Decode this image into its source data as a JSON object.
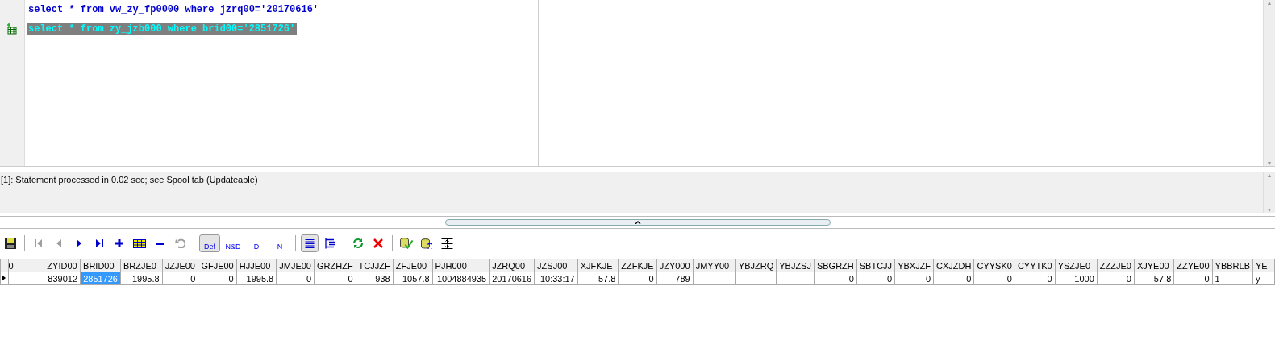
{
  "editor": {
    "lines": [
      {
        "text": "select * from vw_zy_fp0000 where jzrq00='20170616'",
        "selected": false,
        "marker": false
      },
      {
        "text": "select * from zy_jzb000 where brid00='2851726'",
        "selected": true,
        "marker": true
      }
    ]
  },
  "message": {
    "text": "[1]: Statement processed in 0.02 sec; see Spool tab (Updateable)"
  },
  "toolbar": [
    {
      "kind": "icon",
      "disabled": false,
      "selected": false
    },
    {
      "kind": "sep"
    },
    {
      "kind": "icon",
      "disabled": true,
      "selected": false
    },
    {
      "kind": "icon",
      "disabled": true,
      "selected": false
    },
    {
      "kind": "icon",
      "disabled": false,
      "selected": false
    },
    {
      "kind": "icon",
      "disabled": false,
      "selected": false
    },
    {
      "kind": "icon",
      "disabled": false,
      "selected": false
    },
    {
      "kind": "icon",
      "disabled": false,
      "selected": false
    },
    {
      "kind": "icon",
      "disabled": false,
      "selected": false
    },
    {
      "kind": "icon",
      "disabled": true,
      "selected": false
    },
    {
      "kind": "sep"
    },
    {
      "kind": "label",
      "label": "Def",
      "selected": true
    },
    {
      "kind": "label",
      "label": "N&D",
      "selected": false
    },
    {
      "kind": "label",
      "label": "D",
      "selected": false
    },
    {
      "kind": "label",
      "label": "N",
      "selected": false
    },
    {
      "kind": "sep"
    },
    {
      "kind": "icon",
      "disabled": false,
      "selected": true
    },
    {
      "kind": "icon",
      "disabled": false,
      "selected": false
    },
    {
      "kind": "sep"
    },
    {
      "kind": "icon",
      "disabled": false,
      "selected": false
    },
    {
      "kind": "icon",
      "disabled": false,
      "selected": false
    },
    {
      "kind": "sep"
    },
    {
      "kind": "icon",
      "disabled": false,
      "selected": false
    },
    {
      "kind": "icon",
      "disabled": false,
      "selected": false
    },
    {
      "kind": "icon",
      "disabled": false,
      "selected": false
    }
  ],
  "scroll_arrows": {
    "editor_up": "▲",
    "editor_down": "▼",
    "message_up": "▲",
    "message_down": "▼"
  },
  "grid": {
    "columns": [
      "0",
      "ZYID00",
      "BRID00",
      "BRZJE0",
      "JZJE00",
      "GFJE00",
      "HJJE00",
      "JMJE00",
      "GRZHZF",
      "TCJJZF",
      "ZFJE00",
      "PJH000",
      "JZRQ00",
      "JZSJ00",
      "XJFKJE",
      "ZZFKJE",
      "JZY000",
      "JMYY00",
      "YBJZRQ",
      "YBJZSJ",
      "SBGRZH",
      "SBTCJJ",
      "YBXJZF",
      "CXJZDH",
      "CYYSK0",
      "CYYTK0",
      "YSZJE0",
      "ZZZJE0",
      "XJYE00",
      "ZZYE00",
      "YBBRLB",
      "YE"
    ],
    "rows": [
      {
        "current": true,
        "cells": [
          {
            "text": "",
            "selected": false
          },
          {
            "text": "839012",
            "selected": false
          },
          {
            "text": "2851726",
            "selected": true
          },
          {
            "text": "1995.8",
            "selected": false
          },
          {
            "text": "0",
            "selected": false
          },
          {
            "text": "0",
            "selected": false
          },
          {
            "text": "1995.8",
            "selected": false
          },
          {
            "text": "0",
            "selected": false
          },
          {
            "text": "0",
            "selected": false
          },
          {
            "text": "938",
            "selected": false
          },
          {
            "text": "1057.8",
            "selected": false
          },
          {
            "text": "1004884935",
            "selected": false
          },
          {
            "text": "20170616",
            "selected": false
          },
          {
            "text": "10:33:17",
            "selected": false
          },
          {
            "text": "-57.8",
            "selected": false
          },
          {
            "text": "0",
            "selected": false
          },
          {
            "text": "789",
            "selected": false
          },
          {
            "text": "",
            "selected": false
          },
          {
            "text": "",
            "selected": false
          },
          {
            "text": "",
            "selected": false
          },
          {
            "text": "0",
            "selected": false
          },
          {
            "text": "0",
            "selected": false
          },
          {
            "text": "0",
            "selected": false
          },
          {
            "text": "0",
            "selected": false
          },
          {
            "text": "0",
            "selected": false
          },
          {
            "text": "0",
            "selected": false
          },
          {
            "text": "1000",
            "selected": false
          },
          {
            "text": "0",
            "selected": false
          },
          {
            "text": "-57.8",
            "selected": false
          },
          {
            "text": "0",
            "selected": false
          },
          {
            "text": "1",
            "selected": false
          },
          {
            "text": "y",
            "selected": false
          }
        ]
      }
    ]
  }
}
